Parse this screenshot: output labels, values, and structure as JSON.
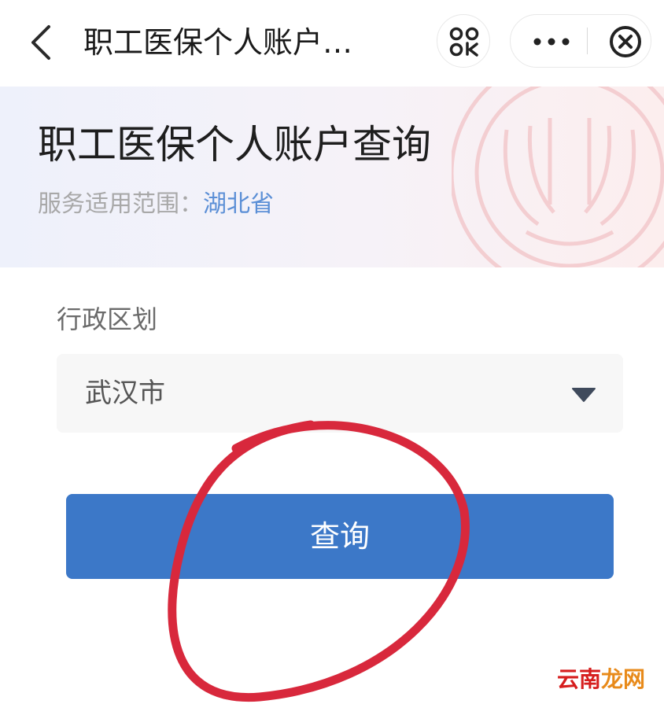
{
  "nav": {
    "title": "职工医保个人账户…",
    "back_icon": "chevron-left-icon",
    "scan_icon": "qr-scan-icon",
    "more_icon": "more-dots-icon",
    "close_icon": "close-circle-icon"
  },
  "hero": {
    "title": "职工医保个人账户查询",
    "scope_label": "服务适用范围：",
    "scope_value": "湖北省",
    "emblem_icon": "emblem-watermark-icon"
  },
  "form": {
    "region_label": "行政区划",
    "region_value": "武汉市",
    "caret_icon": "caret-down-icon"
  },
  "query_button_label": "查询",
  "watermark": {
    "part1": "云南",
    "part2": "龙网"
  },
  "colors": {
    "primary_button": "#3c78c8",
    "scope_link": "#5b8fd6",
    "annotation": "#d8283c",
    "watermark_red": "#d61e1e",
    "watermark_orange": "#e88a1a"
  }
}
